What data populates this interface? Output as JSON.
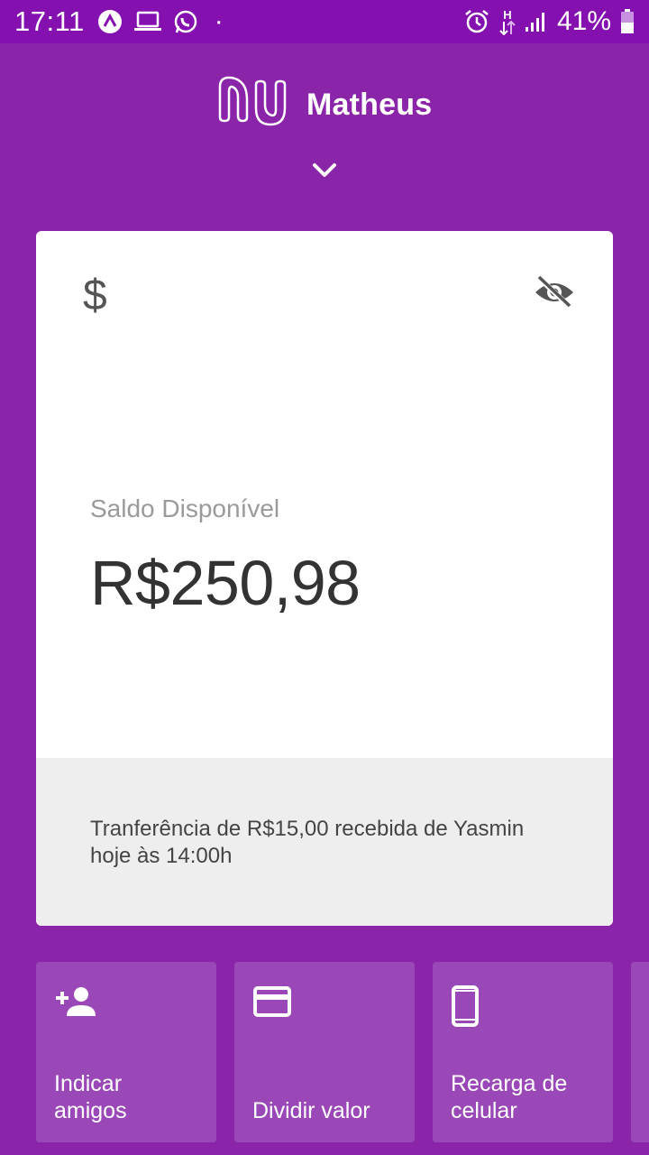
{
  "status_bar": {
    "time": "17:11",
    "dot": "·",
    "network_label": "H",
    "battery_percent": "41%",
    "icons": [
      "app-icon",
      "laptop-icon",
      "whatsapp-icon",
      "alarm-icon",
      "data-arrows-icon",
      "signal-icon",
      "battery-icon"
    ]
  },
  "header": {
    "logo": "nu",
    "user_name": "Matheus",
    "toggle_icon": "chevron-down-icon"
  },
  "account_card": {
    "currency_icon": "$",
    "visibility_icon": "eye-off-icon",
    "balance_label": "Saldo Disponível",
    "balance_value": "R$250,98",
    "notification_line1": "Tranferência de R$15,00 recebida de Yasmin",
    "notification_line2": "hoje às 14:00h"
  },
  "shortcuts": [
    {
      "label_line1": "Indicar",
      "label_line2": "amigos",
      "icon": "add-person-icon"
    },
    {
      "label_line1": "",
      "label_line2": "Dividir valor",
      "icon": "card-icon"
    },
    {
      "label_line1": "Recarga de",
      "label_line2": "celular",
      "icon": "phone-icon"
    }
  ],
  "colors": {
    "background": "#8a24a8",
    "status_bar": "#8410b0",
    "card": "#ffffff",
    "card_footer": "#eeeeee",
    "shortcut_tile": "#9a48b8"
  }
}
